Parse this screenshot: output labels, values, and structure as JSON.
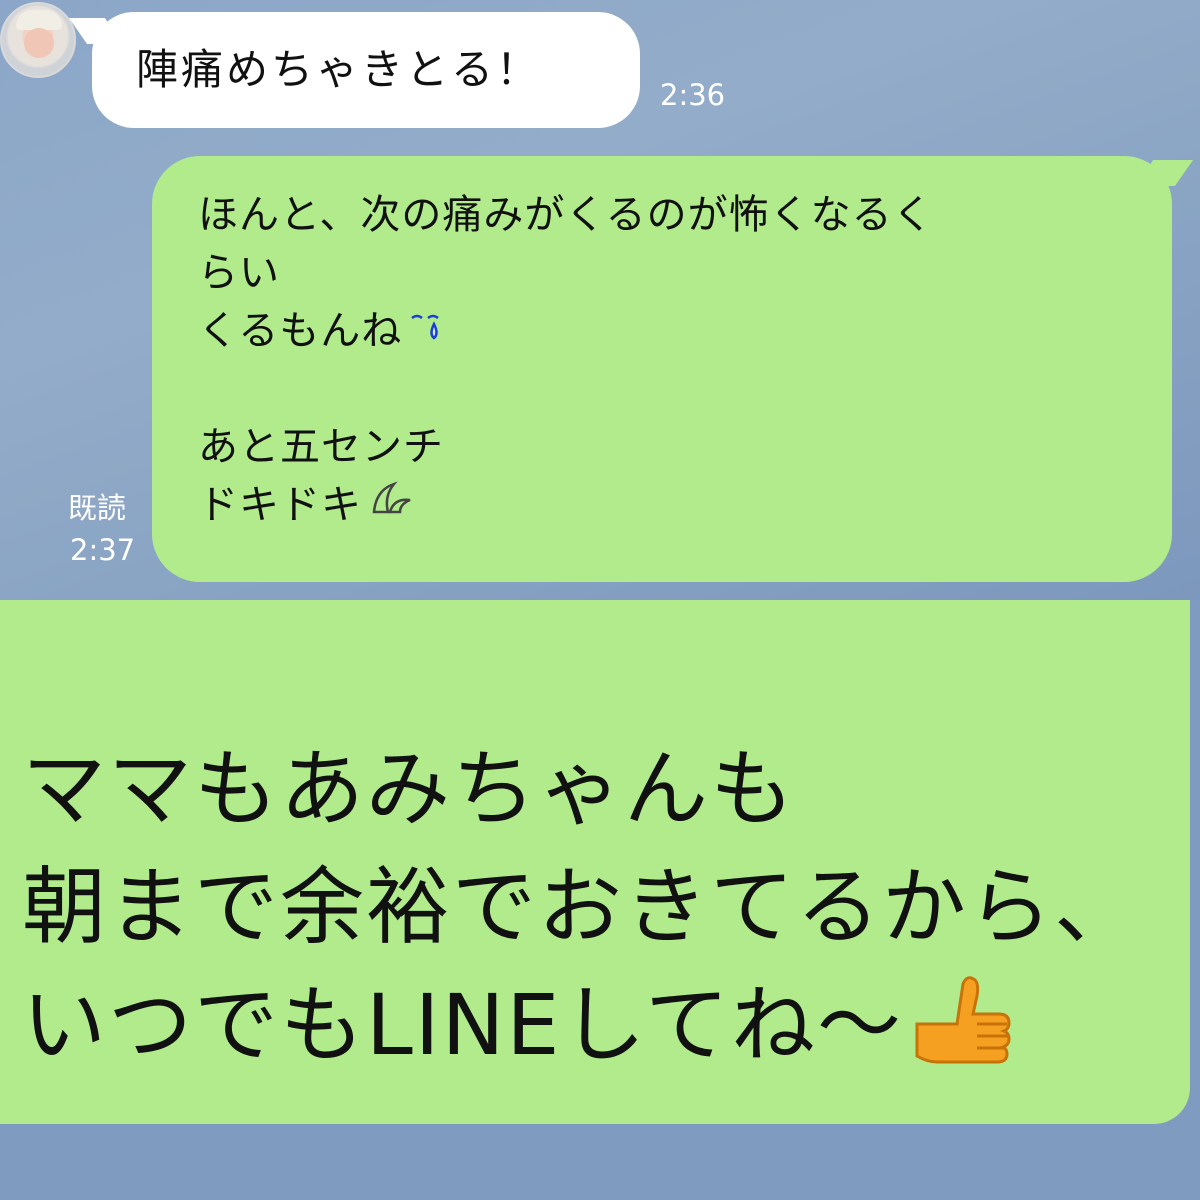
{
  "chat": {
    "incoming": {
      "text": "陣痛めちゃきとる！",
      "time": "2:36",
      "avatar": "baby-photo"
    },
    "outgoing": {
      "lines": [
        "ほんと、次の痛みがくるのが怖くなるく",
        "らい",
        "くるもんね",
        "",
        "あと五センチ",
        "ドキドキ"
      ],
      "emojis": [
        "teardrop-icon",
        "sweat-drop-icon"
      ],
      "read_label": "既読",
      "time": "2:37"
    }
  },
  "caption": {
    "lines": [
      "ママもあみちゃんも",
      "朝まで余裕でおきてるから、",
      "いつでもLINEしてね〜"
    ],
    "emoji": "thumbs-up-icon"
  },
  "colors": {
    "background": "#7f9cc0",
    "incoming_bubble": "#ffffff",
    "outgoing_bubble": "#b1eb8c",
    "thumbs_up": "#f5a020"
  }
}
